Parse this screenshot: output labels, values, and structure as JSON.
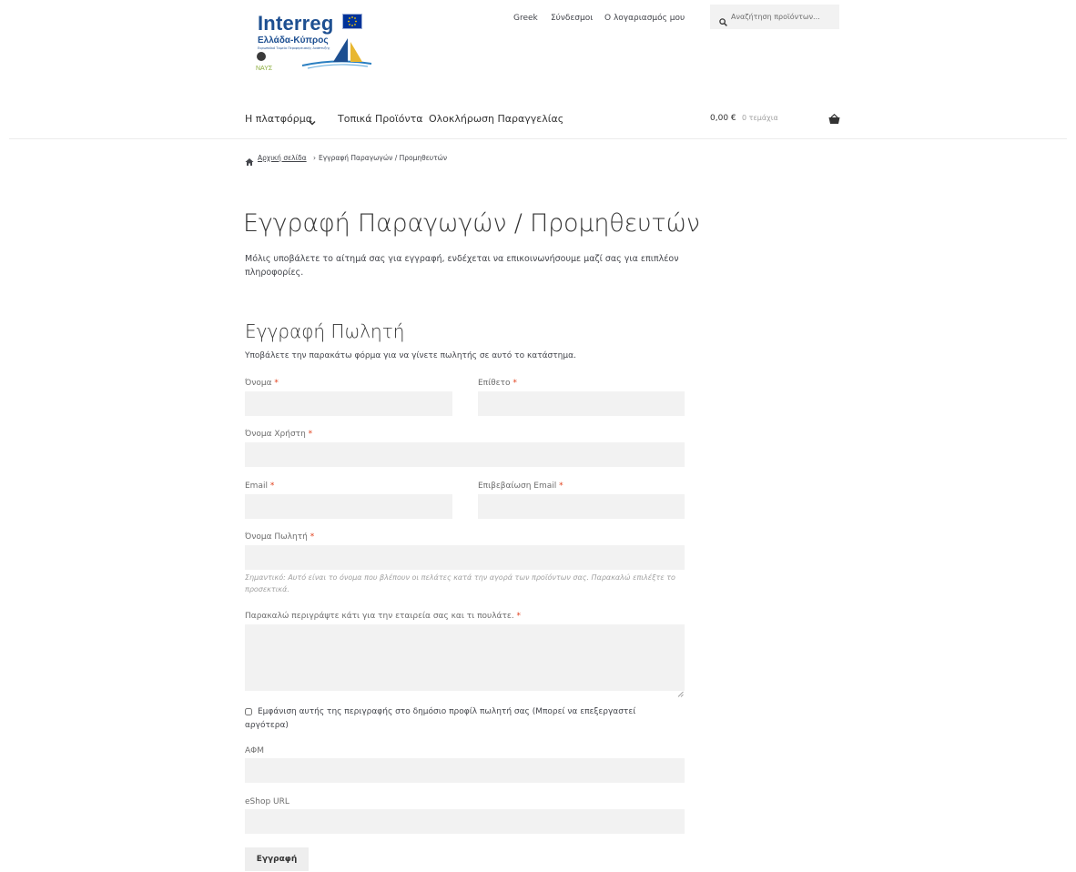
{
  "logo": {
    "word": "Interreg",
    "sub": "Ελλάδα-Κύπρος",
    "tagline": "Ευρωπαϊκό Ταμείο Περιφερειακής Ανάπτυξης",
    "badge": "ΝΑΥΣ"
  },
  "top_nav": {
    "language": "Greek",
    "links": "Σύνδεσμοι",
    "account": "Ο λογαριασμός μου"
  },
  "search": {
    "placeholder": "Αναζήτηση προϊόντων..."
  },
  "main_nav": {
    "platform": "Η πλατφόρμα",
    "products": "Τοπικά Προϊόντα",
    "checkout": "Ολοκλήρωση Παραγγελίας"
  },
  "cart": {
    "amount": "0,00 €",
    "items": "0 τεμάχια"
  },
  "breadcrumb": {
    "home": "Αρχική σελίδα",
    "separator": "›",
    "current": "Εγγραφή Παραγωγών / Προμηθευτών"
  },
  "page": {
    "title": "Εγγραφή Παραγωγών / Προμηθευτών",
    "intro": "Μόλις υποβάλετε το αίτημά σας για εγγραφή, ενδέχεται να επικοινωνήσουμε μαζί σας για επιπλέον πληροφορίες."
  },
  "form": {
    "title": "Εγγραφή Πωλητή",
    "description": "Υποβάλετε την παρακάτω φόρμα για να γίνετε πωλητής σε αυτό το κατάστημα.",
    "required_mark": "*",
    "first_name_label": "Όνομα",
    "last_name_label": "Επίθετο",
    "username_label": "Όνομα Χρήστη",
    "email_label": "Email",
    "confirm_email_label": "Επιβεβαίωση Email",
    "vendor_name_label": "Όνομα Πωλητή",
    "vendor_name_hint": "Σημαντικό: Αυτό είναι το όνομα που βλέπουν οι πελάτες κατά την αγορά των προϊόντων σας. Παρακαλώ επιλέξτε το προσεκτικά.",
    "description_label": "Παρακαλώ περιγράψτε κάτι για την εταιρεία σας και τι πουλάτε.",
    "show_description_label": "Εμφάνιση αυτής της περιγραφής στο δημόσιο προφίλ πωλητή σας (Μπορεί να επεξεργαστεί αργότερα)",
    "vat_label": "ΑΦΜ",
    "eshop_label": "eShop URL",
    "submit_label": "Εγγραφή"
  },
  "colors": {
    "accent_required": "#e2401c",
    "field_bg": "#f2f2f2",
    "logo_blue": "#1d4f91"
  }
}
